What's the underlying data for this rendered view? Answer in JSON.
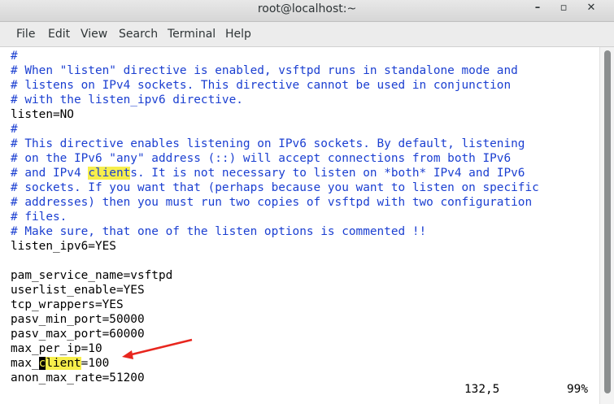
{
  "window": {
    "title": "root@localhost:~",
    "minimize_glyph": "–",
    "maximize_glyph": "▫",
    "close_glyph": "✕"
  },
  "menubar": {
    "items": [
      "File",
      "Edit",
      "View",
      "Search",
      "Terminal",
      "Help"
    ]
  },
  "editor": {
    "lines": [
      "#",
      "# When \"listen\" directive is enabled, vsftpd runs in standalone mode and",
      "# listens on IPv4 sockets. This directive cannot be used in conjunction",
      "# with the listen_ipv6 directive.",
      "listen=NO",
      "#",
      "# This directive enables listening on IPv6 sockets. By default, listening",
      "# on the IPv6 \"any\" address (::) will accept connections from both IPv6",
      "# and IPv4 clients. It is not necessary to listen on *both* IPv4 and IPv6",
      "# sockets. If you want that (perhaps because you want to listen on specific",
      "# addresses) then you must run two copies of vsftpd with two configuration",
      "# files.",
      "# Make sure, that one of the listen options is commented !!",
      "listen_ipv6=YES",
      "",
      "pam_service_name=vsftpd",
      "userlist_enable=YES",
      "tcp_wrappers=YES",
      "pasv_min_port=50000",
      "pasv_max_port=60000",
      "max_per_ip=10",
      "max_client=100",
      "anon_max_rate=51200"
    ],
    "search_term": "client",
    "status_position": "132,5",
    "status_percent": "99%"
  },
  "colors": {
    "comment": "#1b3fd1",
    "highlight": "#f7ef4b",
    "annotation_arrow": "#e8261e"
  }
}
